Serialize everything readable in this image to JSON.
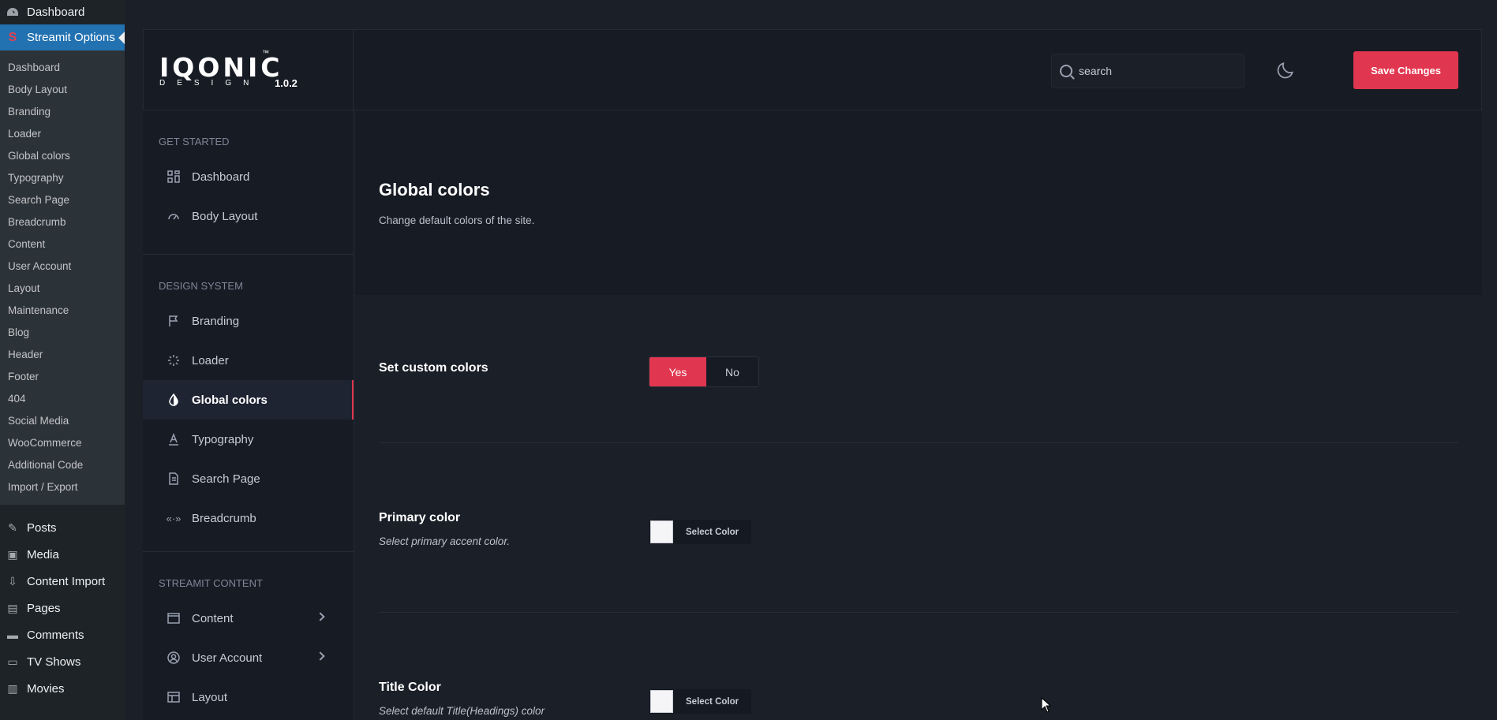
{
  "wp_admin": {
    "top_item": {
      "label": "Dashboard",
      "icon": "dashboard-icon"
    },
    "active_item": {
      "label": "Streamit Options",
      "icon": "streamit-s-icon"
    },
    "submenu": [
      "Dashboard",
      "Body Layout",
      "Branding",
      "Loader",
      "Global colors",
      "Typography",
      "Search Page",
      "Breadcrumb",
      "Content",
      "User Account",
      "Layout",
      "Maintenance",
      "Blog",
      "Header",
      "Footer",
      "404",
      "Social Media",
      "WooCommerce",
      "Additional Code",
      "Import / Export"
    ],
    "menu": [
      {
        "label": "Posts",
        "icon": "pushpin-icon"
      },
      {
        "label": "Media",
        "icon": "media-icon"
      },
      {
        "label": "Content Import",
        "icon": "import-icon"
      },
      {
        "label": "Pages",
        "icon": "pages-icon"
      },
      {
        "label": "Comments",
        "icon": "comments-icon"
      },
      {
        "label": "TV Shows",
        "icon": "tv-icon"
      },
      {
        "label": "Movies",
        "icon": "film-icon"
      }
    ]
  },
  "header": {
    "logo_text": "IQONIC",
    "logo_tm": "™",
    "logo_sub": "DESIGN",
    "version": "1.0.2",
    "search_placeholder": "search",
    "theme_toggle_icon": "moon-icon",
    "save_label": "Save Changes"
  },
  "plugin_nav": {
    "sections": [
      {
        "heading": "GET STARTED",
        "items": [
          {
            "label": "Dashboard",
            "icon": "grid-icon"
          },
          {
            "label": "Body Layout",
            "icon": "gauge-icon"
          }
        ]
      },
      {
        "heading": "DESIGN SYSTEM",
        "items": [
          {
            "label": "Branding",
            "icon": "flag-icon"
          },
          {
            "label": "Loader",
            "icon": "spinner-icon"
          },
          {
            "label": "Global colors",
            "icon": "contrast-icon",
            "active": true
          },
          {
            "label": "Typography",
            "icon": "typography-icon"
          },
          {
            "label": "Search Page",
            "icon": "document-icon"
          },
          {
            "label": "Breadcrumb",
            "icon": "breadcrumb-icon"
          }
        ]
      },
      {
        "heading": "STREAMIT CONTENT",
        "items": [
          {
            "label": "Content",
            "icon": "window-icon",
            "has_children": true
          },
          {
            "label": "User Account",
            "icon": "user-circle-icon",
            "has_children": true
          },
          {
            "label": "Layout",
            "icon": "layout-icon"
          }
        ]
      }
    ]
  },
  "page": {
    "title": "Global colors",
    "description": "Change default colors of the site.",
    "custom_colors": {
      "label": "Set custom colors",
      "yes": "Yes",
      "no": "No",
      "selected": "Yes"
    },
    "primary_color": {
      "label": "Primary color",
      "hint": "Select primary accent color.",
      "button": "Select Color",
      "value": "#f5f5f7"
    },
    "title_color": {
      "label": "Title Color",
      "hint": "Select default Title(Headings) color",
      "button": "Select Color",
      "value": "#f5f5f7"
    }
  },
  "colors": {
    "accent": "#e1364f",
    "wp_highlight": "#2271b1",
    "background": "#1b1f28"
  }
}
